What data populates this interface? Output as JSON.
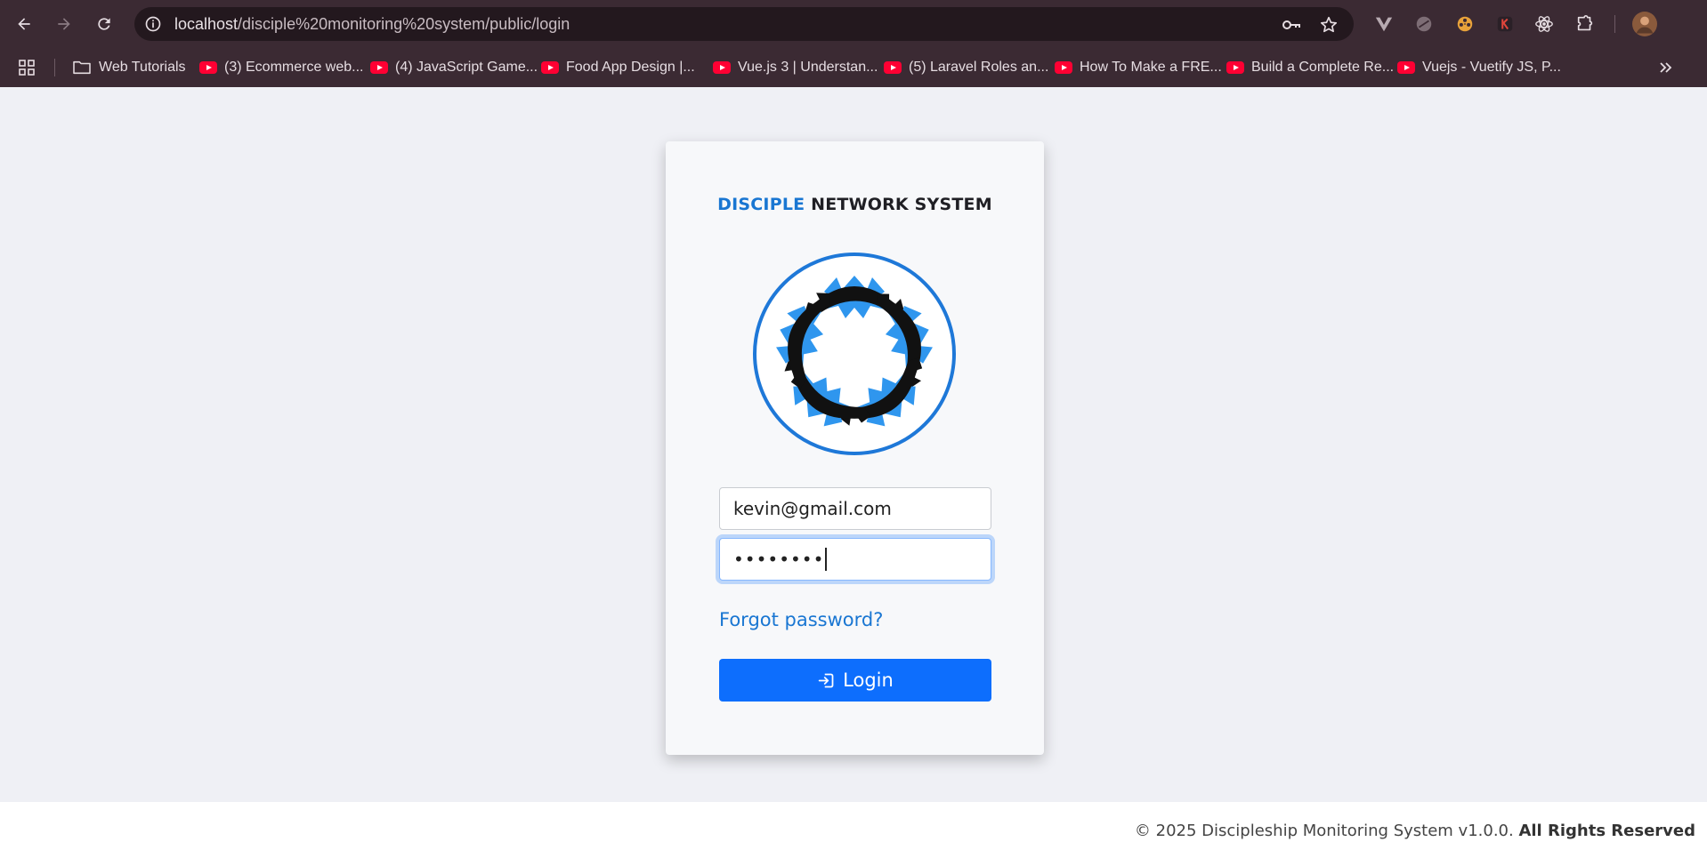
{
  "browser": {
    "url_host": "localhost",
    "url_path": "/disciple%20monitoring%20system/public/login",
    "bookmarks": [
      {
        "label": "Web Tutorials",
        "icon": "folder-icon"
      },
      {
        "label": "(3) Ecommerce web...",
        "icon": "youtube-icon"
      },
      {
        "label": "(4) JavaScript Game...",
        "icon": "youtube-icon"
      },
      {
        "label": "Food App Design |...",
        "icon": "youtube-icon"
      },
      {
        "label": "Vue.js 3 | Understan...",
        "icon": "youtube-icon"
      },
      {
        "label": "(5) Laravel Roles an...",
        "icon": "youtube-icon"
      },
      {
        "label": "How To Make a FRE...",
        "icon": "youtube-icon"
      },
      {
        "label": "Build a Complete Re...",
        "icon": "youtube-icon"
      },
      {
        "label": "Vuejs - Vuetify JS, P...",
        "icon": "youtube-icon"
      }
    ]
  },
  "login": {
    "brand_accent": "DISCIPLE",
    "brand_rest": "NETWORK SYSTEM",
    "email_value": "kevin@gmail.com",
    "password_mask": "••••••••",
    "forgot_label": "Forgot password?",
    "login_label": "Login"
  },
  "footer": {
    "copyright": "© 2025 Discipleship Monitoring System v1.0.0.",
    "rights": "All Rights Reserved"
  },
  "colors": {
    "accent": "#1976d2",
    "button": "#0d6efd",
    "chrome": "#3b2a33",
    "logo_blue": "#2f96ee",
    "logo_black": "#111111"
  }
}
